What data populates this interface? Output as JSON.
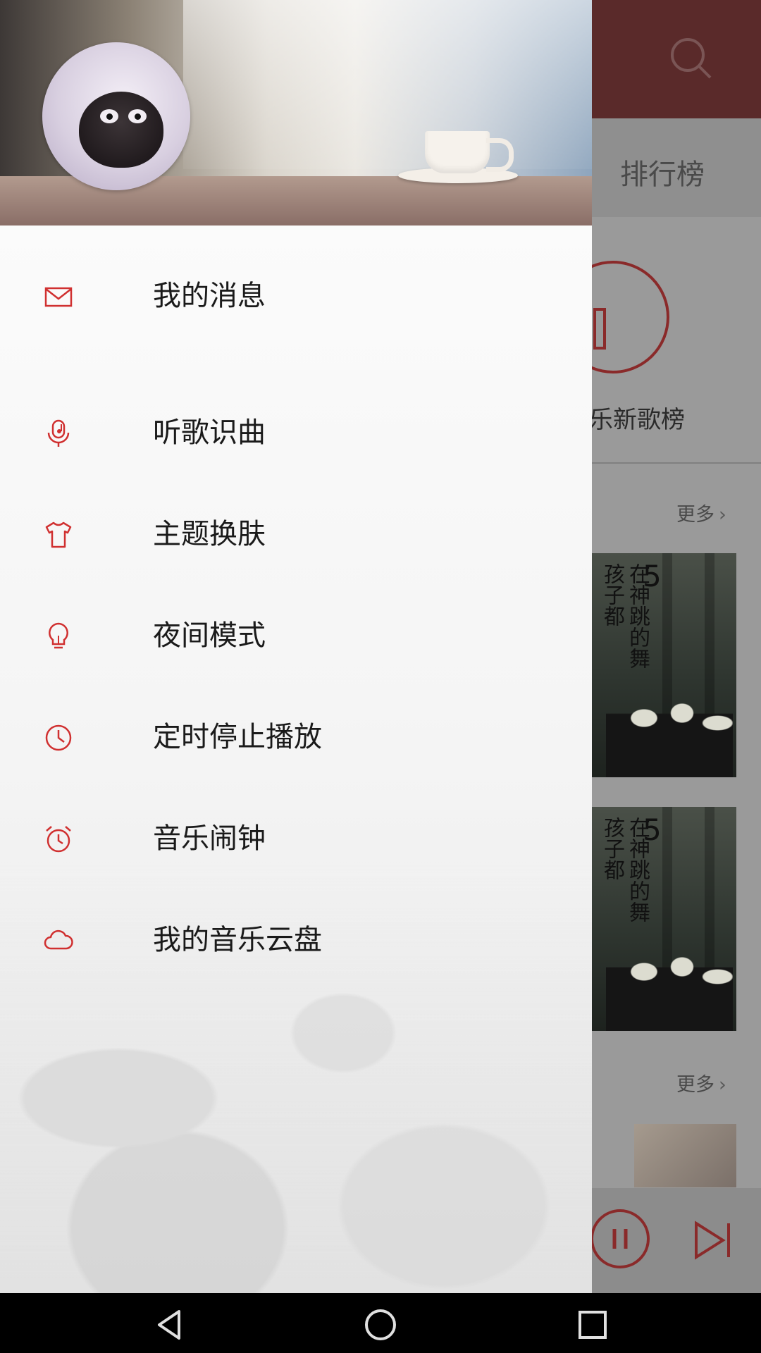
{
  "background_app": {
    "tab_rank": "排行榜",
    "rank_label": "乐新歌榜",
    "more_label": "更多",
    "album": {
      "cover_text": "在神跳的舞孩子都",
      "cover_number": "5"
    }
  },
  "drawer": {
    "menu": [
      {
        "icon": "mail-icon",
        "label": "我的消息"
      },
      {
        "icon": "song-recognition-icon",
        "label": "听歌识曲"
      },
      {
        "icon": "tshirt-icon",
        "label": "主题换肤"
      },
      {
        "icon": "lightbulb-icon",
        "label": "夜间模式"
      },
      {
        "icon": "clock-icon",
        "label": "定时停止播放"
      },
      {
        "icon": "alarm-clock-icon",
        "label": "音乐闹钟"
      },
      {
        "icon": "cloud-icon",
        "label": "我的音乐云盘"
      }
    ]
  },
  "navbar": {
    "buttons": [
      "back-icon",
      "home-icon",
      "recents-icon"
    ]
  },
  "colors": {
    "accent": "#d03030",
    "text": "#1a1a1a",
    "navbar": "#000000"
  }
}
